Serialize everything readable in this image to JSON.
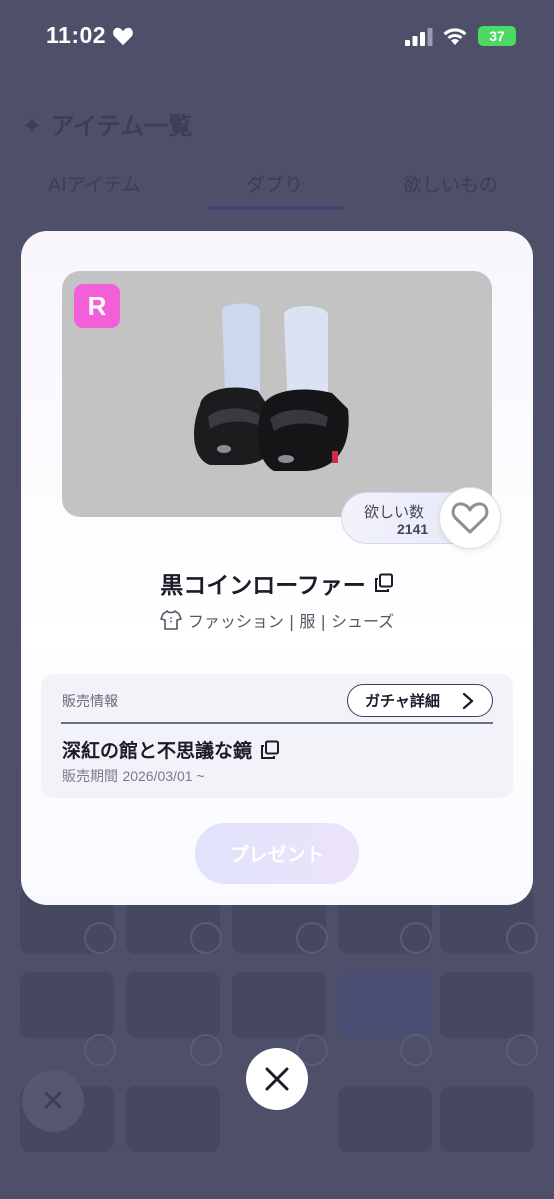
{
  "status_bar": {
    "time": "11:02",
    "battery": "37"
  },
  "background": {
    "title": "✦ アイテム一覧",
    "tabs": [
      {
        "label": "AIアイテム"
      },
      {
        "label": "ダブり"
      },
      {
        "label": "欲しいもの"
      }
    ],
    "active_tab_index": 1
  },
  "modal": {
    "rarity": "R",
    "want": {
      "label": "欲しい数",
      "count": "2141"
    },
    "item_name": "黒コインローファー",
    "category": "ファッション | 服 | シューズ",
    "sale": {
      "label": "販売情報",
      "gacha_button": "ガチャ詳細",
      "event_name": "深紅の館と不思議な鏡",
      "period_label": "販売期間",
      "period_value": "2026/03/01 ~"
    },
    "present_button": "プレゼント"
  },
  "colors": {
    "rarity_badge": "#f25fd8",
    "overlay": "#4d5068",
    "battery": "#4cd964"
  },
  "icons": [
    "heart-icon",
    "signal-icon",
    "wifi-icon",
    "battery-icon",
    "copy-icon",
    "shirt-icon",
    "chevron-right-icon",
    "close-icon"
  ]
}
